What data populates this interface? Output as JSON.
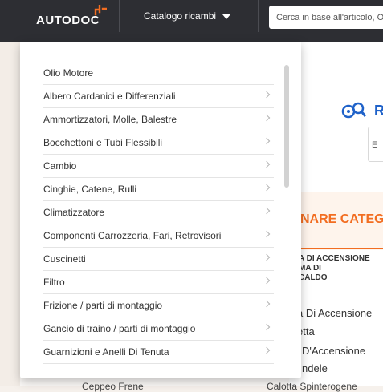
{
  "header": {
    "logo_text": "AUTODOC",
    "catalog_label": "Catalogo ricambi",
    "search_placeholder": "Cerca in base all'articolo, OE"
  },
  "background": {
    "r_letter": "R",
    "box_letter": "E",
    "category_heading": "NARE CATEG",
    "ignition_heading": "A DI ACCENSIONE\nMA DI\nCALDO",
    "links": [
      "a Di Accensione",
      "etta",
      "D'Accensione",
      "ndele"
    ],
    "bottom_left": "Ceppeo Frene",
    "bottom_right": "Calotta Spinterogene"
  },
  "dropdown": {
    "items": [
      {
        "label": "Olio Motore",
        "chevron": false
      },
      {
        "label": "Albero Cardanici e Differenziali",
        "chevron": true
      },
      {
        "label": "Ammortizzatori, Molle, Balestre",
        "chevron": true
      },
      {
        "label": "Bocchettoni e Tubi Flessibili",
        "chevron": true
      },
      {
        "label": "Cambio",
        "chevron": true
      },
      {
        "label": "Cinghie, Catene, Rulli",
        "chevron": true
      },
      {
        "label": "Climatizzatore",
        "chevron": true
      },
      {
        "label": "Componenti Carrozzeria, Fari, Retrovisori",
        "chevron": true
      },
      {
        "label": "Cuscinetti",
        "chevron": true
      },
      {
        "label": "Filtro",
        "chevron": true
      },
      {
        "label": "Frizione / parti di montaggio",
        "chevron": true
      },
      {
        "label": "Gancio di traino / parti di montaggio",
        "chevron": true
      },
      {
        "label": "Guarnizioni e Anelli Di Tenuta",
        "chevron": true
      }
    ]
  },
  "colors": {
    "topbar": "#2d2e33",
    "accent_orange": "#f26d21",
    "accent_blue": "#1f62c9"
  }
}
